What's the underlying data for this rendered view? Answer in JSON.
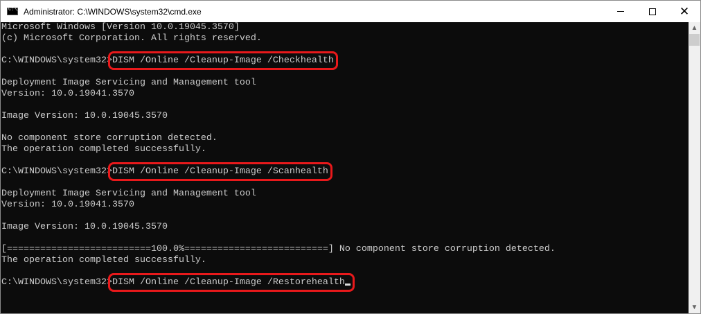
{
  "window": {
    "title": "Administrator: C:\\WINDOWS\\system32\\cmd.exe",
    "minimize_label": "minimize",
    "maximize_label": "maximize",
    "close_label": "close"
  },
  "console": {
    "lines": [
      {
        "text": "Microsoft Windows [Version 10.0.19045.3570]"
      },
      {
        "text": "(c) Microsoft Corporation. All rights reserved."
      },
      {
        "text": ""
      },
      {
        "prompt": "C:\\WINDOWS\\system32>",
        "command": "DISM /Online /Cleanup-Image /Checkhealth"
      },
      {
        "text": ""
      },
      {
        "text": "Deployment Image Servicing and Management tool"
      },
      {
        "text": "Version: 10.0.19041.3570"
      },
      {
        "text": ""
      },
      {
        "text": "Image Version: 10.0.19045.3570"
      },
      {
        "text": ""
      },
      {
        "text": "No component store corruption detected."
      },
      {
        "text": "The operation completed successfully."
      },
      {
        "text": ""
      },
      {
        "prompt": "C:\\WINDOWS\\system32>",
        "command": "DISM /Online /Cleanup-Image /Scanhealth"
      },
      {
        "text": ""
      },
      {
        "text": "Deployment Image Servicing and Management tool"
      },
      {
        "text": "Version: 10.0.19041.3570"
      },
      {
        "text": ""
      },
      {
        "text": "Image Version: 10.0.19045.3570"
      },
      {
        "text": ""
      },
      {
        "text": "[==========================100.0%==========================] No component store corruption detected."
      },
      {
        "text": "The operation completed successfully."
      },
      {
        "text": ""
      },
      {
        "prompt": "C:\\WINDOWS\\system32>",
        "command": "DISM /Online /Cleanup-Image /Restorehealth",
        "cursor": true
      }
    ],
    "highlight_color": "#e8191b"
  }
}
